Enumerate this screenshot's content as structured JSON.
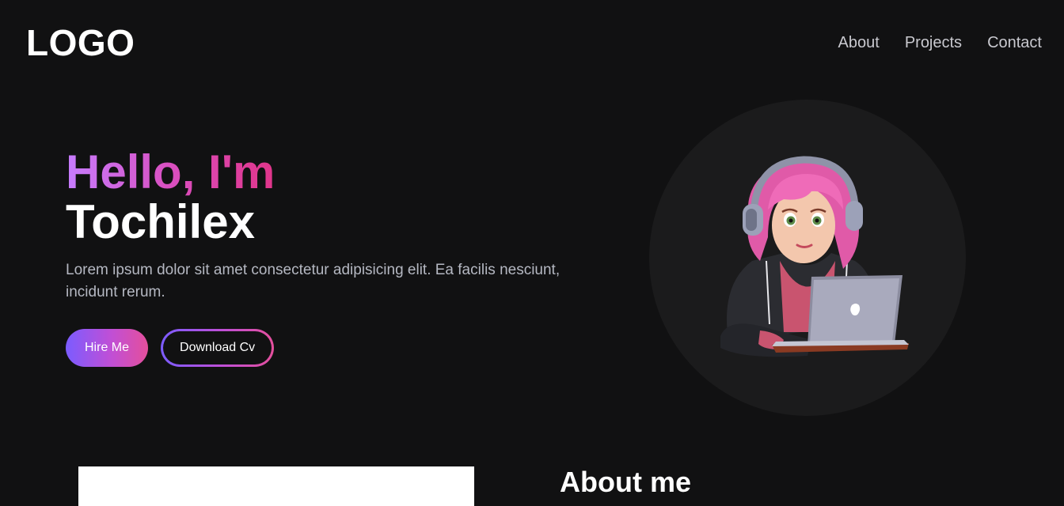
{
  "header": {
    "logo": "LOGO",
    "nav": [
      {
        "label": "About"
      },
      {
        "label": "Projects"
      },
      {
        "label": "Contact"
      }
    ]
  },
  "hero": {
    "greeting": "Hello, I'm",
    "name": "Tochilex",
    "description": "Lorem ipsum dolor sit amet consectetur adipisicing elit. Ea facilis nesciunt, incidunt rerum.",
    "hire_button": "Hire Me",
    "download_button": "Download Cv",
    "avatar_icon": "avatar-illustration"
  },
  "about": {
    "title": "About me"
  },
  "colors": {
    "background": "#111112",
    "accent_start": "#7b5cff",
    "accent_end": "#e44f9c",
    "circle": "#1b1b1c"
  }
}
